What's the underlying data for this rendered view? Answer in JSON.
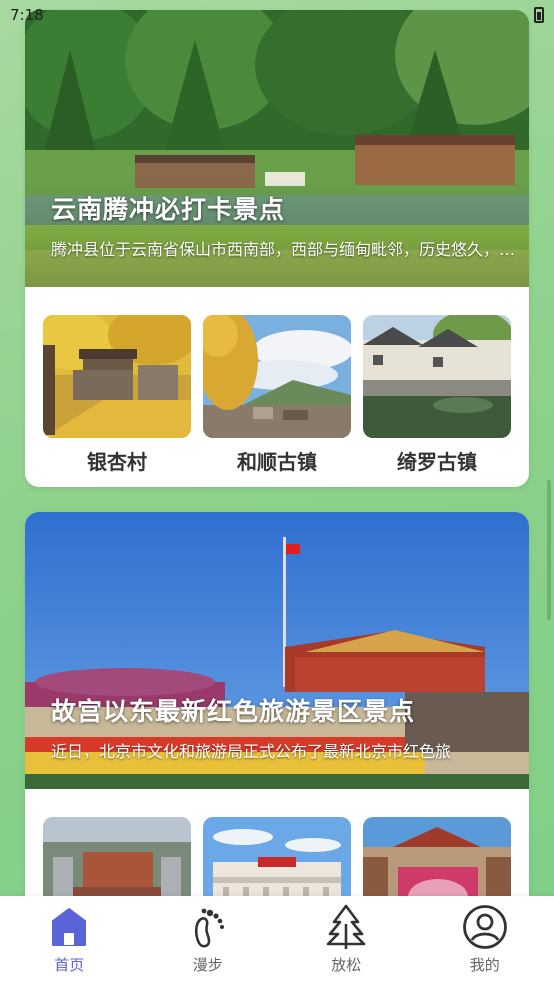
{
  "status_bar": {
    "time": "7:18"
  },
  "feed": [
    {
      "title": "云南腾冲必打卡景点",
      "description": "腾冲县位于云南省保山市西南部，西部与缅甸毗邻，历史悠久，人文荟萃",
      "spots": [
        {
          "name": "银杏村"
        },
        {
          "name": "和顺古镇"
        },
        {
          "name": "绮罗古镇"
        }
      ]
    },
    {
      "title": "故宫以东最新红色旅游景区景点",
      "description": "近日，北京市文化和旅游局正式公布了最新北京市红色旅",
      "spots": [
        {
          "name": ""
        },
        {
          "name": ""
        },
        {
          "name": ""
        }
      ]
    }
  ],
  "bottom_nav": {
    "items": [
      {
        "label": "首页",
        "icon": "home-icon",
        "active": true
      },
      {
        "label": "漫步",
        "icon": "footprint-icon",
        "active": false
      },
      {
        "label": "放松",
        "icon": "tree-icon",
        "active": false
      },
      {
        "label": "我的",
        "icon": "profile-icon",
        "active": false
      }
    ],
    "active_color": "#5b63d9",
    "inactive_color": "#666666"
  }
}
